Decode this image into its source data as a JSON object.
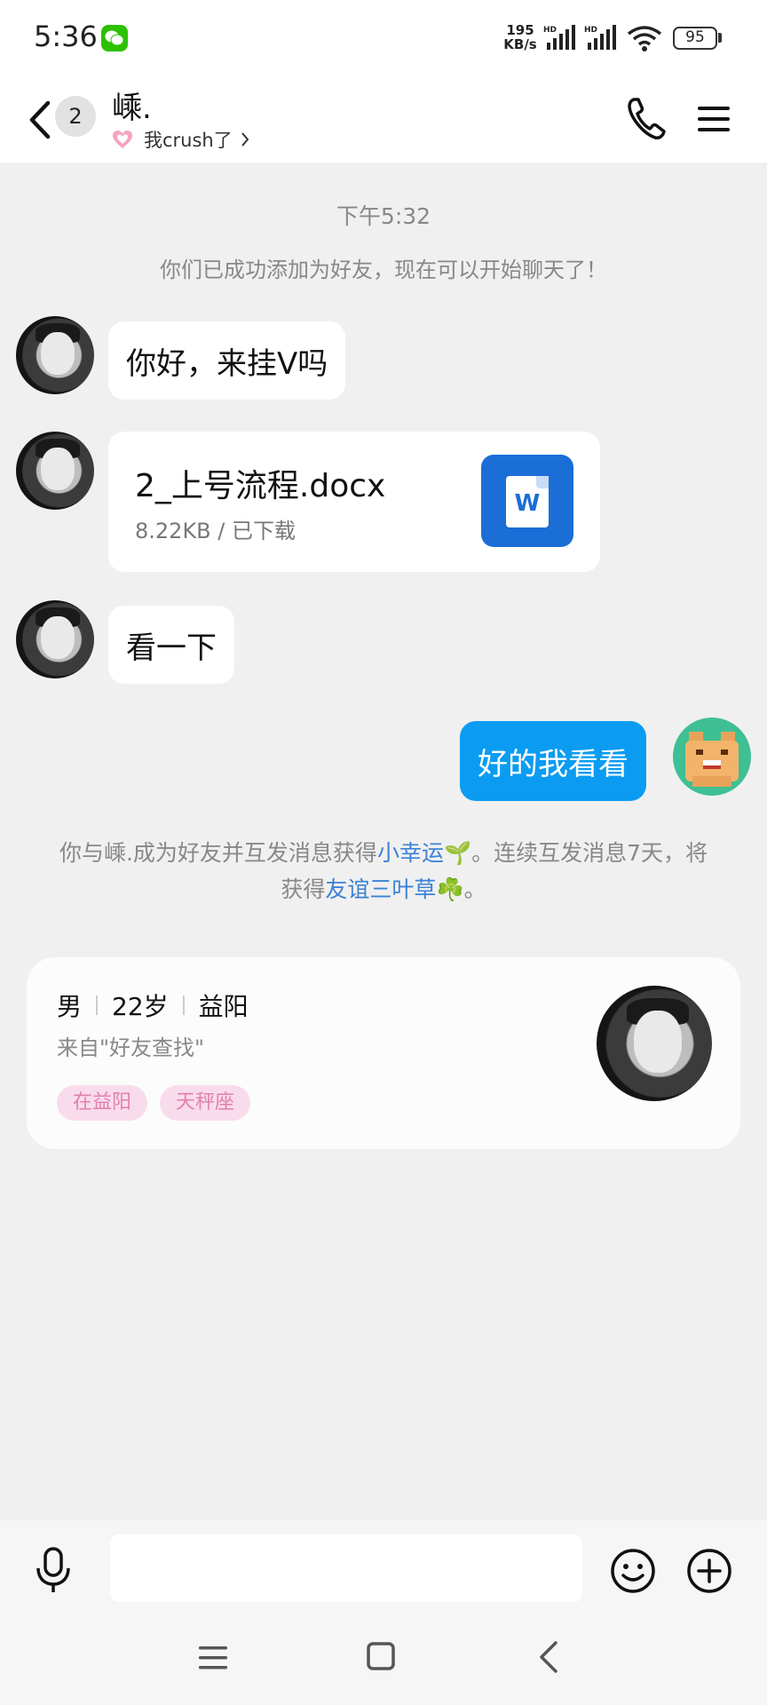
{
  "status_bar": {
    "time": "5:36",
    "app_icon": "wechat-icon",
    "net_speed_value": "195",
    "net_speed_unit": "KB/s",
    "signal_label": "HD",
    "battery": "95"
  },
  "header": {
    "unread_count": "2",
    "contact_name": "嵊.",
    "relation_label": "我crush了",
    "icons": [
      "back-arrow-icon",
      "heart-icon",
      "chevron-right-icon",
      "phone-icon",
      "menu-icon"
    ]
  },
  "chat": {
    "timestamp": "下午5:32",
    "system_message": "你们已成功添加为好友，现在可以开始聊天了！",
    "messages": [
      {
        "sender": "friend",
        "type": "text",
        "text": "你好，来挂V吗"
      },
      {
        "sender": "friend",
        "type": "file",
        "file_name": "2_上号流程.docx",
        "file_meta": "8.22KB / 已下载",
        "file_icon_letter": "W"
      },
      {
        "sender": "friend",
        "type": "text",
        "text": "看一下"
      },
      {
        "sender": "self",
        "type": "text",
        "text": "好的我看看"
      }
    ],
    "luck_message": {
      "part1": "你与嵊.成为好友并互发消息获得",
      "link1": "小幸运",
      "part2": "。连续互发消息7天，将获得",
      "link2": "友谊三叶草",
      "part3": "。",
      "link1_emoji": "🌱",
      "link2_emoji": "☘️"
    }
  },
  "profile_card": {
    "gender": "男",
    "age": "22岁",
    "city": "益阳",
    "source": "来自\"好友查找\"",
    "tags": [
      "在益阳",
      "天秤座"
    ]
  },
  "input_bar": {
    "placeholder": "",
    "icons": [
      "mic-icon",
      "emoji-icon",
      "plus-icon"
    ]
  },
  "nav_bar": {
    "icons": [
      "nav-menu-icon",
      "nav-home-icon",
      "nav-back-icon"
    ]
  },
  "colors": {
    "self_bubble": "#0b9cf2",
    "link": "#3b82d6",
    "tag_bg": "#f9dceb",
    "tag_text": "#e07fb0",
    "word_blue": "#1b6ed6"
  }
}
